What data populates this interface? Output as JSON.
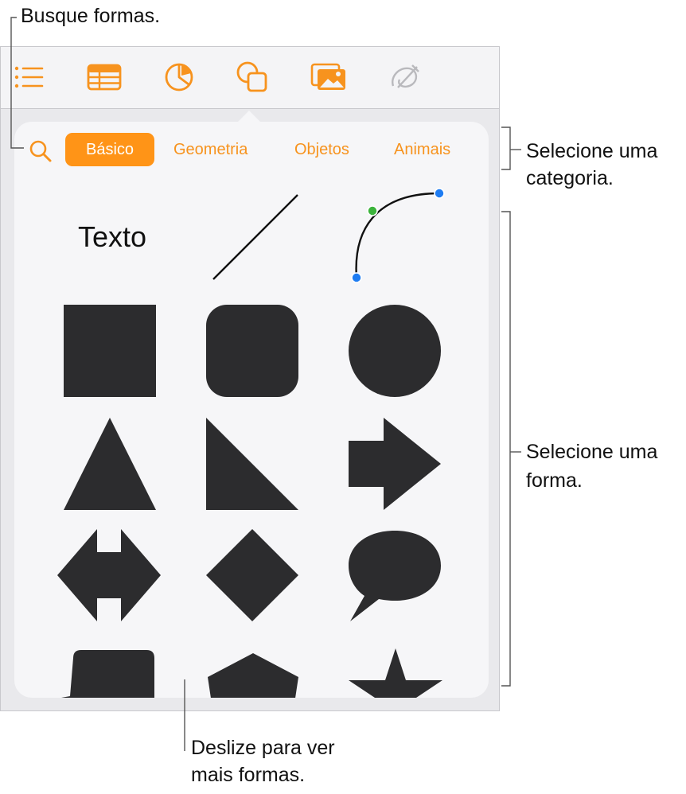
{
  "callouts": {
    "search": "Busque formas.",
    "category_line1": "Selecione uma",
    "category_line2": "categoria.",
    "shape_line1": "Selecione uma",
    "shape_line2": "forma.",
    "scroll_line1": "Deslize para ver",
    "scroll_line2": "mais formas."
  },
  "toolbar": {
    "items": [
      {
        "icon": "list-icon"
      },
      {
        "icon": "table-icon"
      },
      {
        "icon": "chart-icon"
      },
      {
        "icon": "shapes-icon",
        "selected": true
      },
      {
        "icon": "media-icon"
      },
      {
        "icon": "drawing-icon",
        "disabled": true
      }
    ]
  },
  "shapes_popover": {
    "categories": [
      "Básico",
      "Geometria",
      "Objetos",
      "Animais"
    ],
    "selected_category": "Básico",
    "text_shape_label": "Texto",
    "shapes": [
      "text",
      "line",
      "curve",
      "square",
      "rounded-square",
      "circle",
      "triangle",
      "right-triangle",
      "arrow",
      "double-arrow",
      "diamond",
      "speech-bubble",
      "callout-rect",
      "pentagon",
      "star"
    ]
  },
  "colors": {
    "accent": "#ff9417",
    "shape_fill": "#2c2c2e",
    "curve_end_point": "#1e7cf2",
    "curve_control_point": "#3bb33b"
  }
}
